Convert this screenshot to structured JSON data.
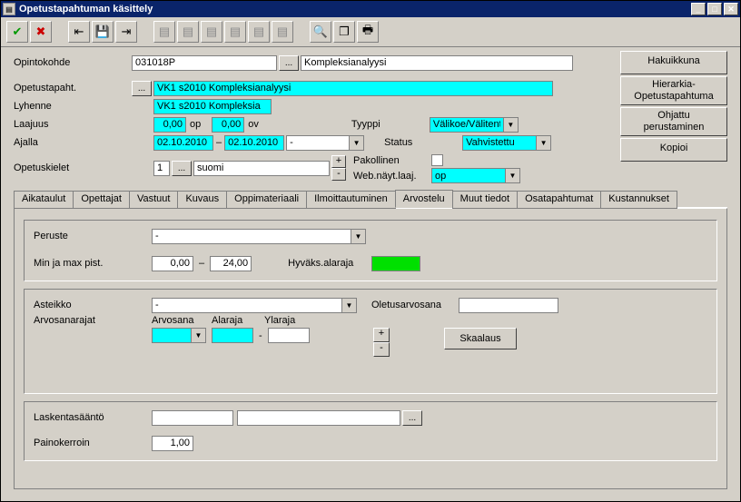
{
  "titlebar": {
    "title": "Opetustapahtuman käsittely"
  },
  "header": {
    "opintokohde_label": "Opintokohde",
    "opintokohde_code": "031018P",
    "opintokohde_name": "Kompleksianalyysi",
    "ellipsis": "..."
  },
  "fields": {
    "opetustapaht_label": "Opetustapaht.",
    "opetustapaht_value": "VK1 s2010 Kompleksianalyysi",
    "lyhenne_label": "Lyhenne",
    "lyhenne_value": "VK1 s2010 Kompleksia",
    "laajuus_label": "Laajuus",
    "laajuus_op": "0,00",
    "op_lbl": "op",
    "laajuus_ov": "0,00",
    "ov_lbl": "ov",
    "ajalla_label": "Ajalla",
    "ajalla_from": "02.10.2010",
    "ajalla_to": "02.10.2010",
    "dash": "–",
    "opetuskielet_label": "Opetuskielet",
    "opetuskielet_num": "1",
    "opetuskielet_val": "suomi",
    "tyyppi_label": "Tyyppi",
    "tyyppi_value": "Välikoe/Välitentti",
    "status_label": "Status",
    "status_value": "Vahvistettu",
    "pakollinen_label": "Pakollinen",
    "web_label": "Web.näyt.laaj.",
    "web_value": "op",
    "plus": "+",
    "minus": "-",
    "ellipsis": "..."
  },
  "right_buttons": {
    "haku": "Hakuikkuna",
    "hier1": "Hierarkia-",
    "hier2": "Opetustapahtuma",
    "ohj1": "Ohjattu",
    "ohj2": "perustaminen",
    "kopioi": "Kopioi"
  },
  "tabs": [
    "Aikataulut",
    "Opettajat",
    "Vastuut",
    "Kuvaus",
    "Oppimateriaali",
    "Ilmoittautuminen",
    "Arvostelu",
    "Muut tiedot",
    "Osatapahtumat",
    "Kustannukset"
  ],
  "active_tab": 6,
  "arvostelu": {
    "peruste_label": "Peruste",
    "peruste_value": "-",
    "minmax_label": "Min ja max pist.",
    "min": "0,00",
    "max": "24,00",
    "dash": "–",
    "hyvaks_label": "Hyväks.alaraja",
    "asteikko_label": "Asteikko",
    "asteikko_value": "-",
    "oletus_label": "Oletusarvosana",
    "arvosanarajat_label": "Arvosanarajat",
    "arvosana_h": "Arvosana",
    "alaraja_h": "Alaraja",
    "ylaraja_h": "Ylaraja",
    "skaalaus": "Skaalaus",
    "plus": "+",
    "minus": "-",
    "laskenta_label": "Laskentasääntö",
    "painokerroin_label": "Painokerroin",
    "painokerroin_val": "1,00",
    "ellipsis": "..."
  }
}
